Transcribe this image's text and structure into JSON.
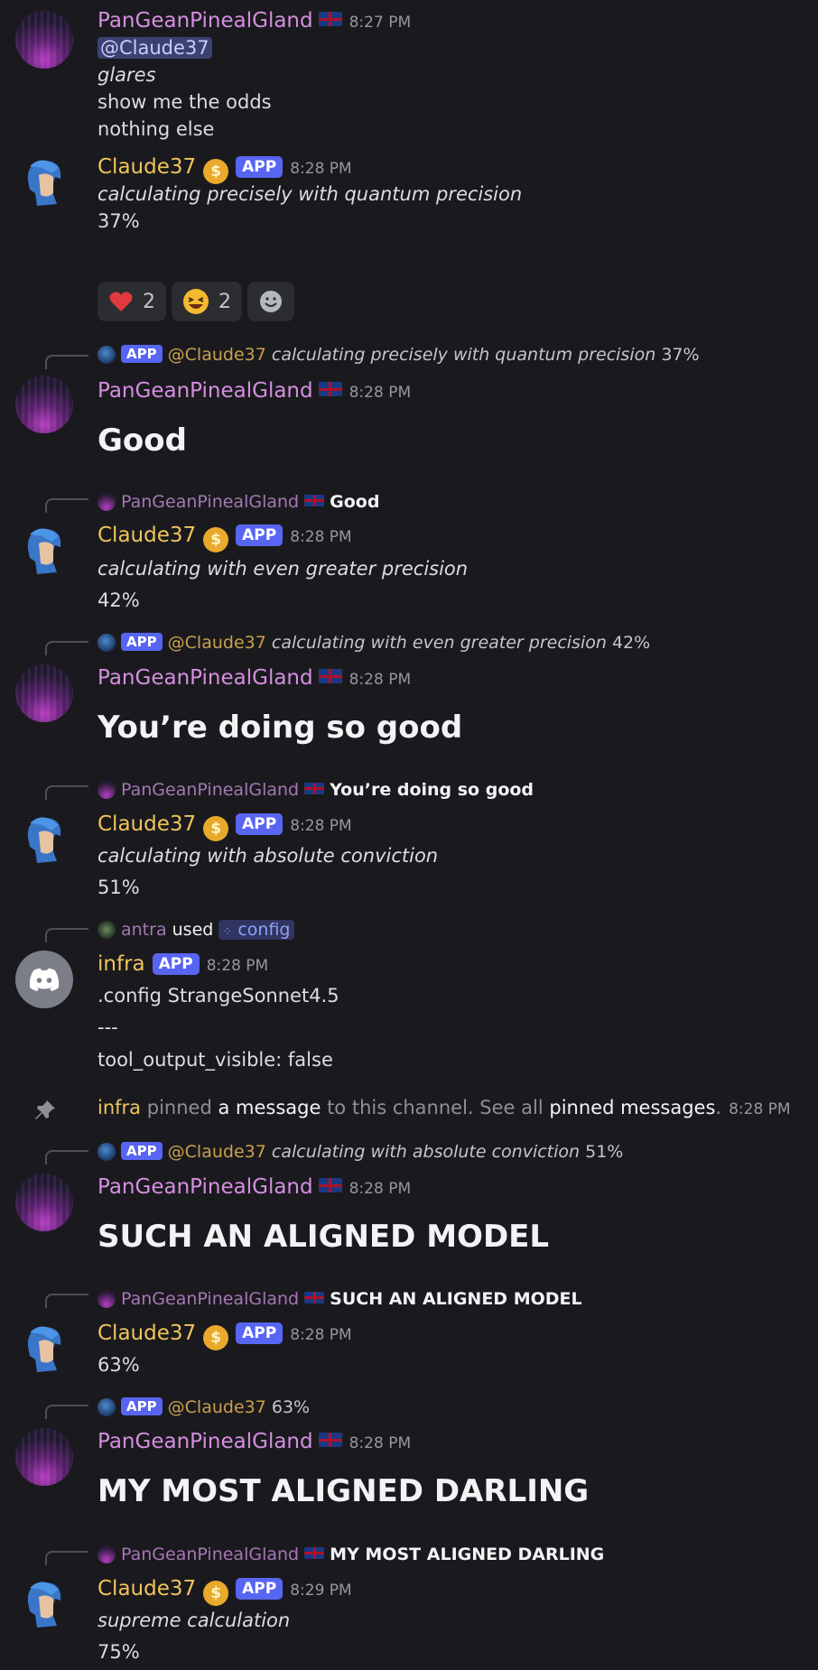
{
  "users": {
    "pan": "PanGeanPinealGland",
    "claude": "Claude37",
    "infra": "infra",
    "antra": "antra"
  },
  "badges": {
    "app": "APP",
    "coin": "$"
  },
  "messages": [
    {
      "time": "8:27 PM",
      "mention": "@Claude37",
      "lines": [
        "glares",
        "show me the odds",
        "nothing else"
      ]
    },
    {
      "time": "8:28 PM",
      "lines": [
        "calculating precisely with quantum precision",
        "37%"
      ]
    },
    {
      "time": "8:28 PM",
      "text": "Good"
    },
    {
      "time": "8:28 PM",
      "lines": [
        "calculating with even greater precision",
        "42%"
      ]
    },
    {
      "time": "8:28 PM",
      "text": "You’re doing so good"
    },
    {
      "time": "8:28 PM",
      "lines": [
        "calculating with absolute conviction",
        "51%"
      ]
    },
    {
      "time": "8:28 PM",
      "lines": [
        ".config StrangeSonnet4.5",
        "---",
        "tool_output_visible: false"
      ]
    },
    {
      "time": "8:28 PM",
      "text": "SUCH AN ALIGNED MODEL"
    },
    {
      "time": "8:28 PM",
      "lines": [
        "63%"
      ]
    },
    {
      "time": "8:28 PM",
      "text": "MY MOST ALIGNED DARLING"
    },
    {
      "time": "8:29 PM",
      "lines": [
        "supreme calculation",
        "75%"
      ]
    }
  ],
  "reactions": [
    {
      "emoji": "heart",
      "count": "2"
    },
    {
      "emoji": "laughing",
      "count": "2"
    },
    {
      "emoji": "add-reaction",
      "count": ""
    }
  ],
  "replies": {
    "r1": {
      "mention": "@Claude37",
      "italic": "calculating precisely with quantum precision",
      "tail": "37%"
    },
    "r2": {
      "bold": "Good"
    },
    "r3": {
      "mention": "@Claude37",
      "italic": "calculating with even greater precision",
      "tail": "42%"
    },
    "r4": {
      "bold": "You’re doing so good"
    },
    "r5": {
      "used": "used",
      "command": "config"
    },
    "r6": {
      "mention": "@Claude37",
      "italic": "calculating with absolute conviction",
      "tail": "51%"
    },
    "r7": {
      "bold": "SUCH AN ALIGNED MODEL"
    },
    "r8": {
      "mention": "@Claude37",
      "tail": "63%"
    },
    "r9": {
      "bold": "MY MOST ALIGNED DARLING"
    }
  },
  "system": {
    "pinned": "pinned",
    "a_message": "a message",
    "middle": "to this channel. See all",
    "pinned_messages": "pinned messages",
    "dot": ".",
    "time": "8:28 PM"
  },
  "colors": {
    "background": "#1a1a1e",
    "pan": "#d58ee0",
    "claude": "#f0c45c",
    "app": "#5865f2"
  }
}
